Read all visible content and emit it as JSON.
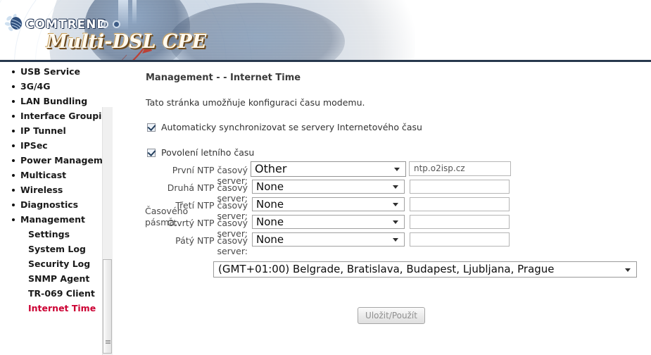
{
  "banner": {
    "brand": "COMTREND",
    "product": "Multi-DSL CPE",
    "logo_icon": "comtrend-flower-logo"
  },
  "sidebar": {
    "items": [
      {
        "label": "USB Service",
        "level": "top",
        "active": false
      },
      {
        "label": "3G/4G",
        "level": "top",
        "active": false
      },
      {
        "label": "LAN Bundling",
        "level": "top",
        "active": false
      },
      {
        "label": "Interface Groupin",
        "level": "top",
        "active": false
      },
      {
        "label": "IP Tunnel",
        "level": "top",
        "active": false
      },
      {
        "label": "IPSec",
        "level": "top",
        "active": false
      },
      {
        "label": "Power Manageme",
        "level": "top",
        "active": false
      },
      {
        "label": "Multicast",
        "level": "top",
        "active": false
      },
      {
        "label": "Wireless",
        "level": "top",
        "active": false
      },
      {
        "label": "Diagnostics",
        "level": "top",
        "active": false
      },
      {
        "label": "Management",
        "level": "top",
        "active": false
      },
      {
        "label": "Settings",
        "level": "sub",
        "active": false
      },
      {
        "label": "System Log",
        "level": "sub",
        "active": false
      },
      {
        "label": "Security Log",
        "level": "sub",
        "active": false
      },
      {
        "label": "SNMP Agent",
        "level": "sub",
        "active": false
      },
      {
        "label": "TR-069 Client",
        "level": "sub",
        "active": false
      },
      {
        "label": "Internet Time",
        "level": "sub",
        "active": true
      }
    ],
    "scrollbar": {
      "up_arrow_icon": "chevron-up-icon",
      "grip_icon": "scroll-grip-icon"
    }
  },
  "content": {
    "title": "Management - - Internet Time",
    "description": "Tato stránka umožňuje konfiguraci času modemu.",
    "checkbox_auto_sync": {
      "label": "Automaticky synchronizovat se servery Internetového času",
      "checked": true
    },
    "checkbox_dst": {
      "label": "Povolení letního času",
      "checked": true
    },
    "ntp_servers": [
      {
        "label": "První NTP časový server:",
        "selected": "Other",
        "value": "ntp.o2isp.cz"
      },
      {
        "label": "Druhá NTP časový server:",
        "selected": "None",
        "value": ""
      },
      {
        "label": "Třetí NTP časový server:",
        "selected": "None",
        "value": ""
      },
      {
        "label": "Čtvrtý NTP časový server:",
        "selected": "None",
        "value": ""
      },
      {
        "label": "Pátý NTP časový server:",
        "selected": "None",
        "value": ""
      }
    ],
    "timezone": {
      "label_line1": "Časového",
      "label_line2": "pásma:",
      "selected": "(GMT+01:00) Belgrade, Bratislava, Budapest, Ljubljana, Prague"
    },
    "submit_label": "Uložit/Použít"
  },
  "colors": {
    "active_nav": "#cc0033",
    "banner_dark": "#1b2d4a",
    "title_text": "#3b3b3b"
  }
}
